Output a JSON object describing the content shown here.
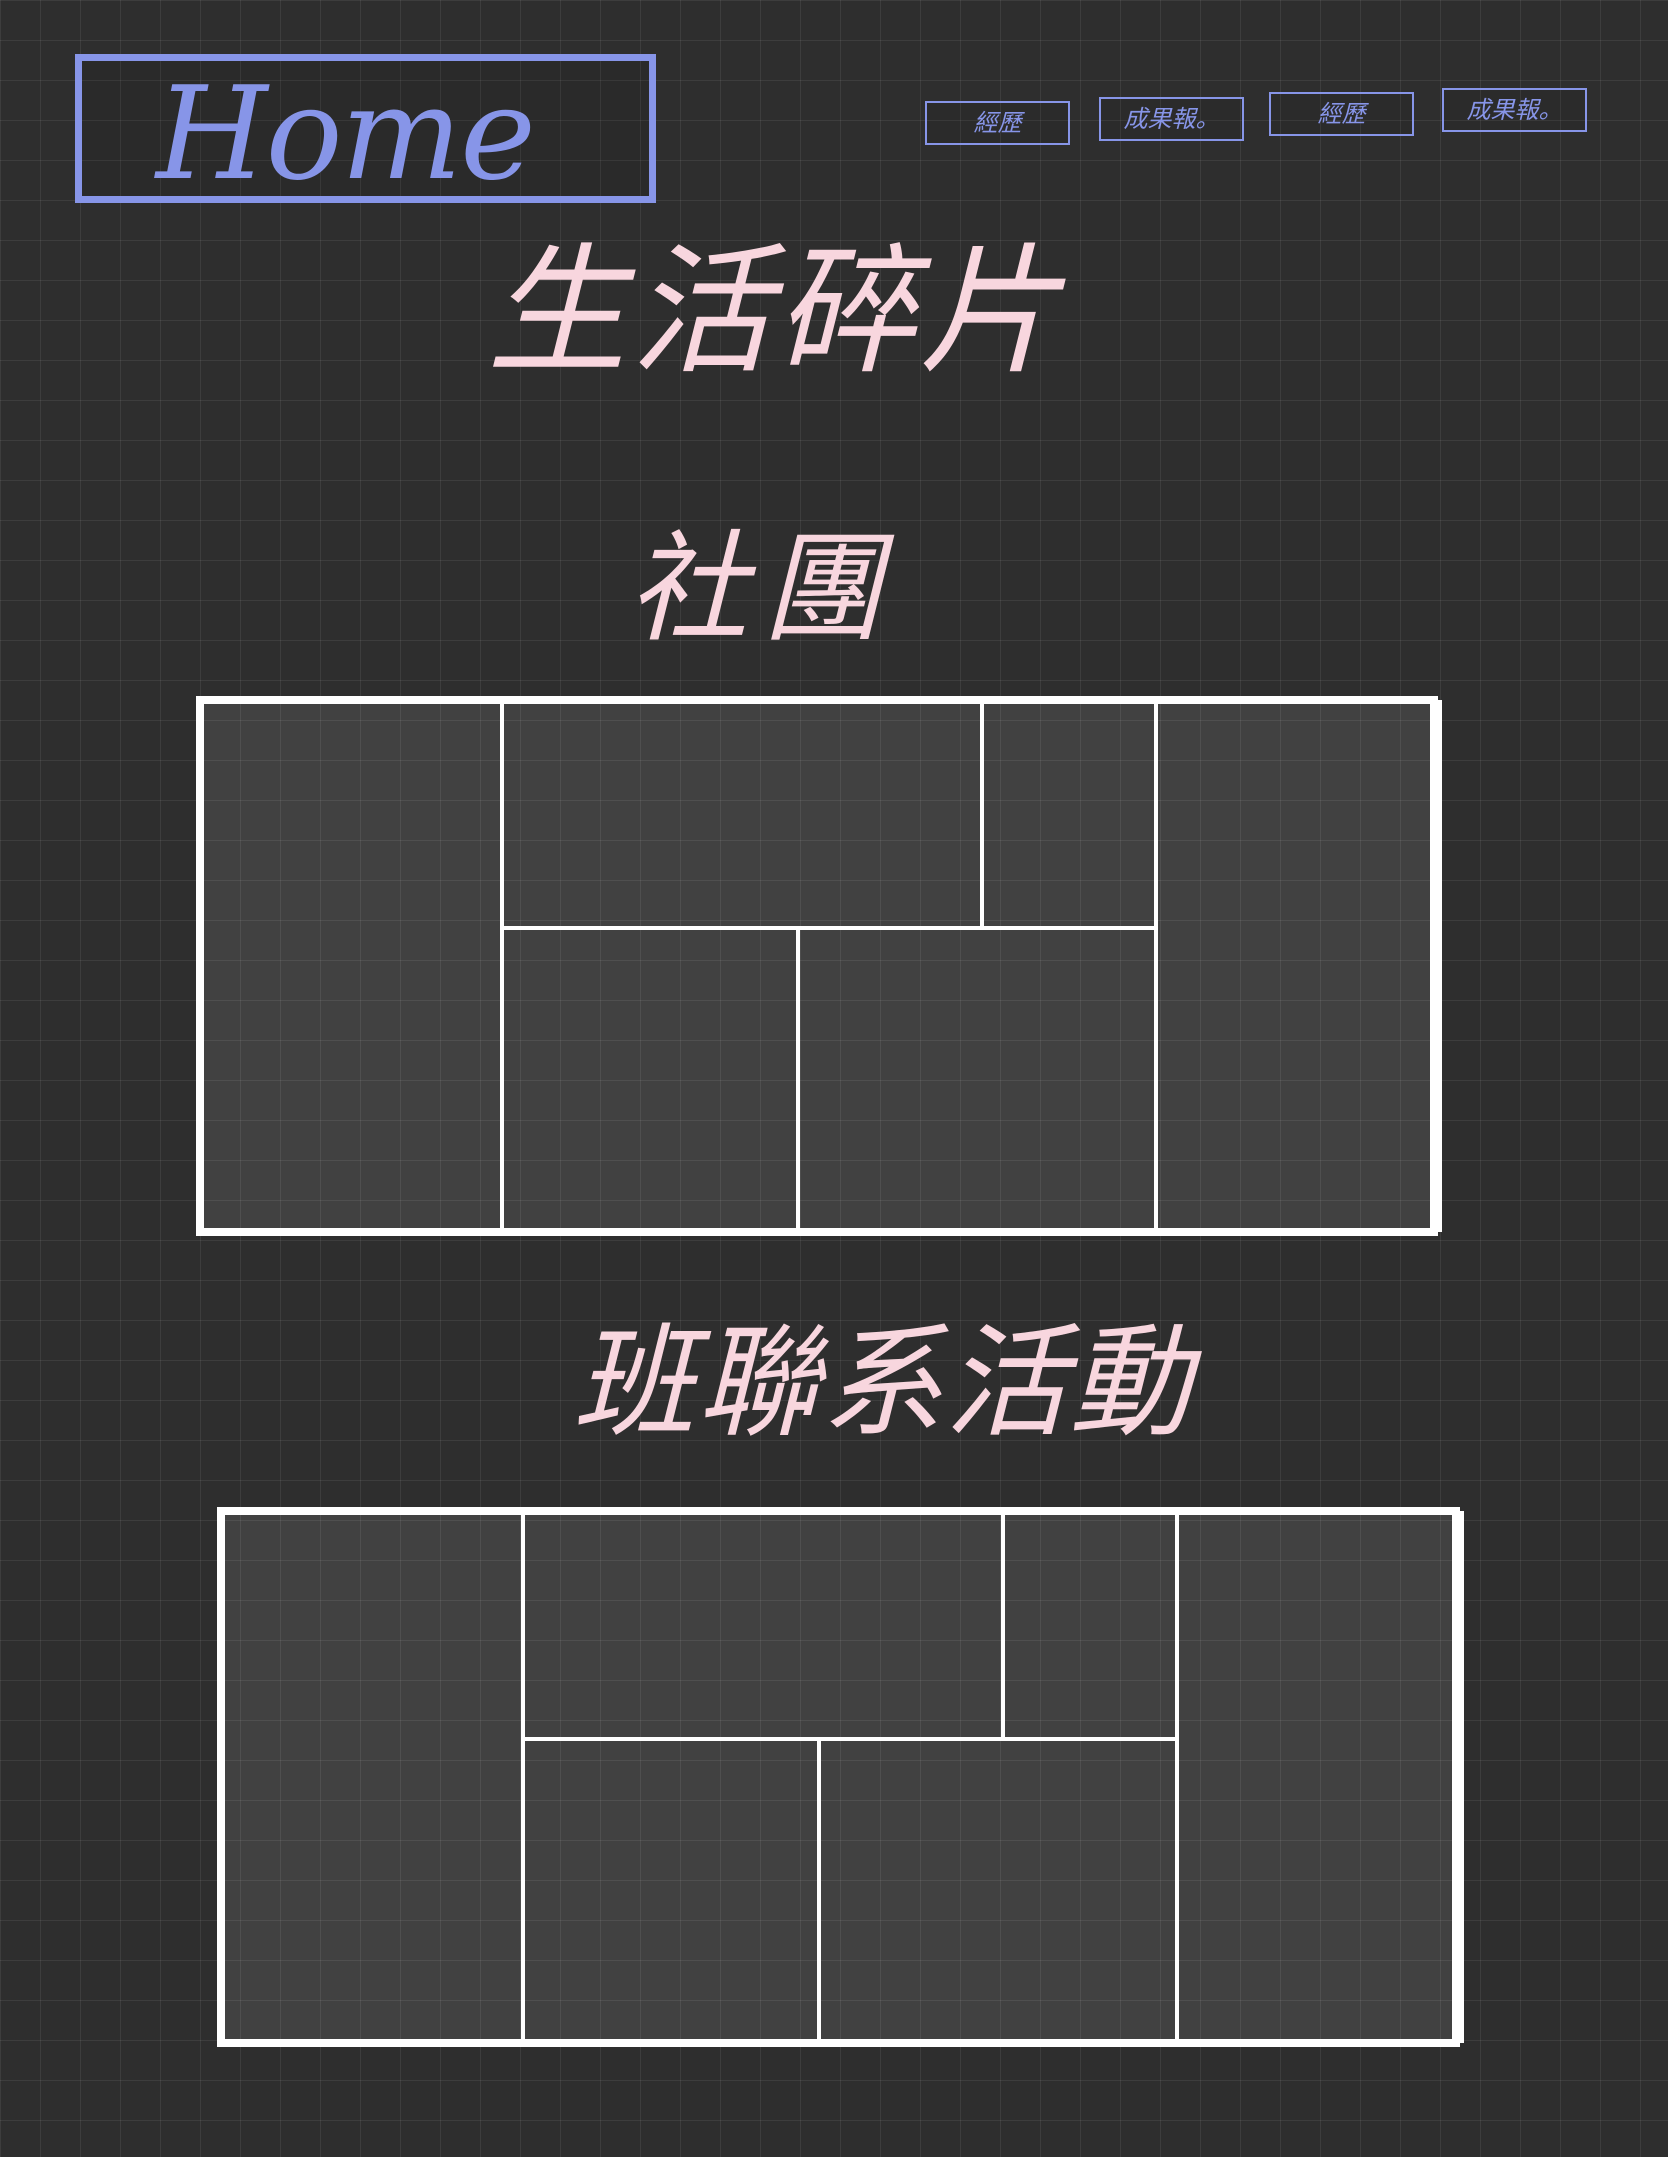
{
  "header": {
    "home_label": "Home"
  },
  "nav": {
    "tabs": [
      {
        "label": "經歷"
      },
      {
        "label": "成果報。"
      },
      {
        "label": "經歷"
      },
      {
        "label": "成果報。"
      }
    ]
  },
  "main": {
    "title": "生活碎片",
    "club_heading": "社團",
    "activity_heading": "班聯系活動"
  },
  "colors": {
    "background": "#2e2e2e",
    "accent_blue": "#8795e8",
    "handwriting_pink": "#f8d6de",
    "frame_white": "#ffffff"
  }
}
